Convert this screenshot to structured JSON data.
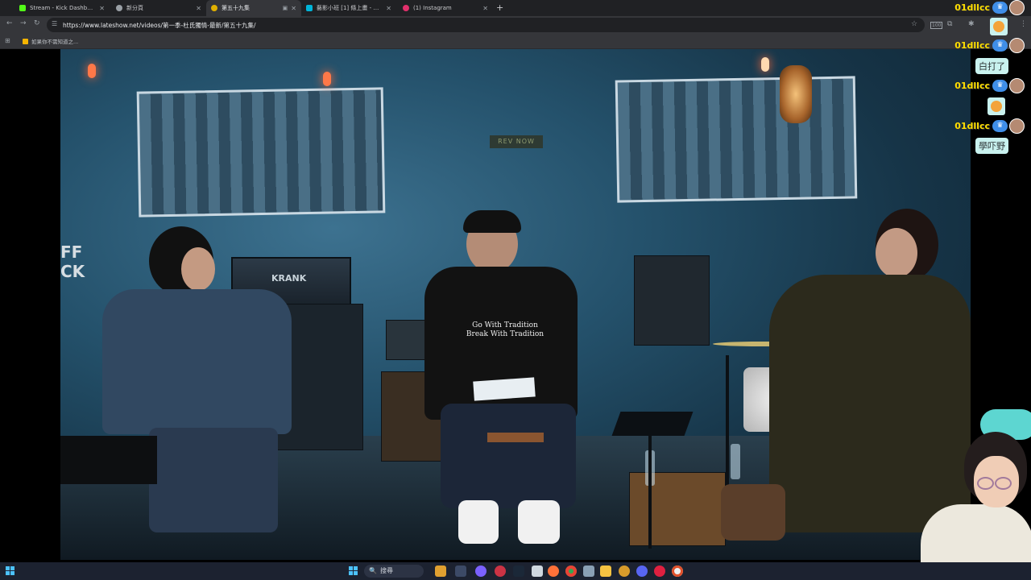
{
  "browser": {
    "tabs": [
      {
        "title": "Stream - Kick Dashboard",
        "favicon_color": "#53fc18",
        "active": false
      },
      {
        "title": "新分頁",
        "favicon_color": "#9aa0a6",
        "active": false
      },
      {
        "title": "第五十九集",
        "favicon_color": "#e0b000",
        "active": true
      },
      {
        "title": "藝影小班 [1] 條上畫 - 巴哈姆特",
        "favicon_color": "#00b4d8",
        "active": false
      },
      {
        "title": "(1) Instagram",
        "favicon_color": "#e1306c",
        "active": false
      }
    ],
    "new_tab_label": "+",
    "url": "https://www.lateshow.net/videos/第一季-杜氏獨情-最新/第五十九集/",
    "bookmark": "如果你不需知道之...",
    "zoom_badge": "100"
  },
  "video": {
    "wall_sign": "REV NOW",
    "amp_brand": "KRANK",
    "tshirt_line1": "Go With Tradition",
    "tshirt_line2": "Break With Tradition",
    "cube_text_1": "FF",
    "cube_text_2": "CK"
  },
  "chat": {
    "username": "01dllcc",
    "messages": [
      {
        "type": "text",
        "text": "白打了"
      },
      {
        "type": "sticker",
        "text": ""
      },
      {
        "type": "text",
        "text": "學吓野"
      }
    ]
  },
  "taskbar": {
    "search_placeholder": "搜尋",
    "search_icon": "🔍"
  }
}
